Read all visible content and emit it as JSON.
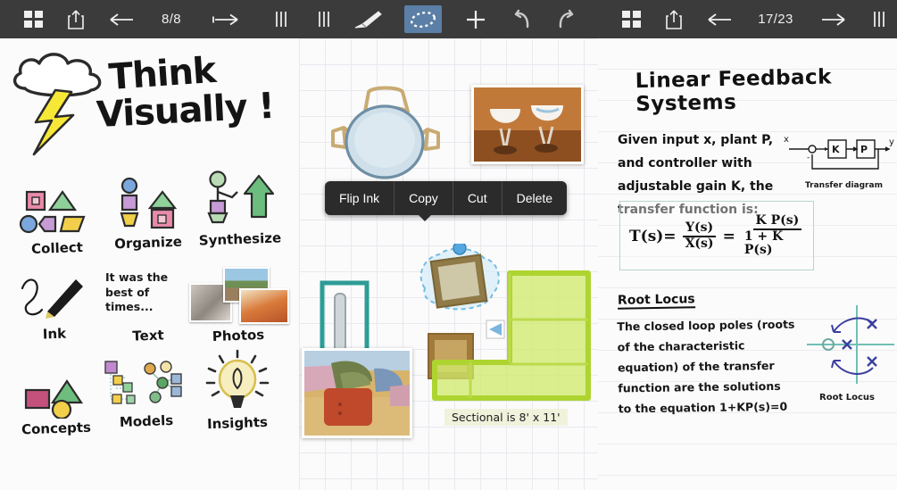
{
  "panels": [
    {
      "id": "whiteboard",
      "toolbar": {
        "grid_icon": "grid-view-icon",
        "share_icon": "share-upload-icon",
        "back_icon": "arrow-left-icon",
        "page_indicator": "8/8",
        "forward_icon": "arrow-right-fit-icon",
        "grip_icon": "menu-grip-icon"
      },
      "title_line1": "Think",
      "title_line2": "Visually !",
      "cells": [
        {
          "label": "Collect",
          "icon": "shapes-cluster-icon"
        },
        {
          "label": "Organize",
          "icon": "stacked-shapes-icon"
        },
        {
          "label": "Synthesize",
          "icon": "figure-arrow-icon"
        },
        {
          "label": "Ink",
          "icon": "pen-scribble-icon"
        },
        {
          "label": "Text",
          "icon": "text-sample-icon",
          "sample": "It was the best of times..."
        },
        {
          "label": "Photos",
          "icon": "photo-stack-icon"
        },
        {
          "label": "Concepts",
          "icon": "concept-shapes-icon"
        },
        {
          "label": "Models",
          "icon": "node-graph-icon"
        },
        {
          "label": "Insights",
          "icon": "lightbulb-icon"
        }
      ]
    },
    {
      "id": "grid-canvas",
      "toolbar": {
        "grip_icon": "menu-grip-icon",
        "pen_icon": "pen-tool-icon",
        "lasso_icon": "lasso-select-icon",
        "add_icon": "plus-icon",
        "undo_icon": "undo-arrow-icon",
        "redo_icon": "redo-arrow-icon",
        "active_tool": "lasso-select-icon",
        "active_color": "#5b7fa6"
      },
      "context_menu": [
        "Flip Ink",
        "Copy",
        "Cut",
        "Delete"
      ],
      "annotation": "Sectional is 8' x 11'",
      "objects": [
        {
          "name": "round-table-sketch"
        },
        {
          "name": "chairs-photo"
        },
        {
          "name": "teal-rectangle-sketch"
        },
        {
          "name": "selected-square-sketch"
        },
        {
          "name": "brown-square-sketch"
        },
        {
          "name": "green-sectional-sketch"
        },
        {
          "name": "couch-photo"
        }
      ]
    },
    {
      "id": "notes",
      "toolbar": {
        "grid_icon": "grid-view-icon",
        "share_icon": "share-upload-icon",
        "back_icon": "arrow-left-icon",
        "page_indicator": "17/23",
        "forward_icon": "arrow-right-icon",
        "grip_icon": "menu-grip-icon"
      },
      "heading": "Linear Feedback Systems",
      "body": "Given input x, plant P, and controller with adjustable gain K, the transfer function is:",
      "equation": {
        "lhs": "T(s)=",
        "frac1_num": "Y(s)",
        "frac1_den": "X(s)",
        "eq2": "=",
        "frac2_num": "K P(s)",
        "frac2_den": "1 + K P(s)"
      },
      "diagram_caption": "Transfer diagram",
      "diagram_labels": {
        "input": "x",
        "output": "y",
        "block1": "K",
        "block2": "P"
      },
      "section_heading": "Root Locus",
      "section_body": "The closed loop poles (roots of the characteristic equation) of the transfer function are the solutions to the equation 1+KP(s)=0",
      "locus_caption": "Root Locus"
    }
  ],
  "colors": {
    "toolbar_bg": "#3b3b3b",
    "accent_selected": "#5b7fa6",
    "menu_bg": "#2b2b2b",
    "sketch_green": "#b5d935",
    "sketch_teal": "#2e9c96",
    "sketch_brown": "#a07b3c"
  }
}
